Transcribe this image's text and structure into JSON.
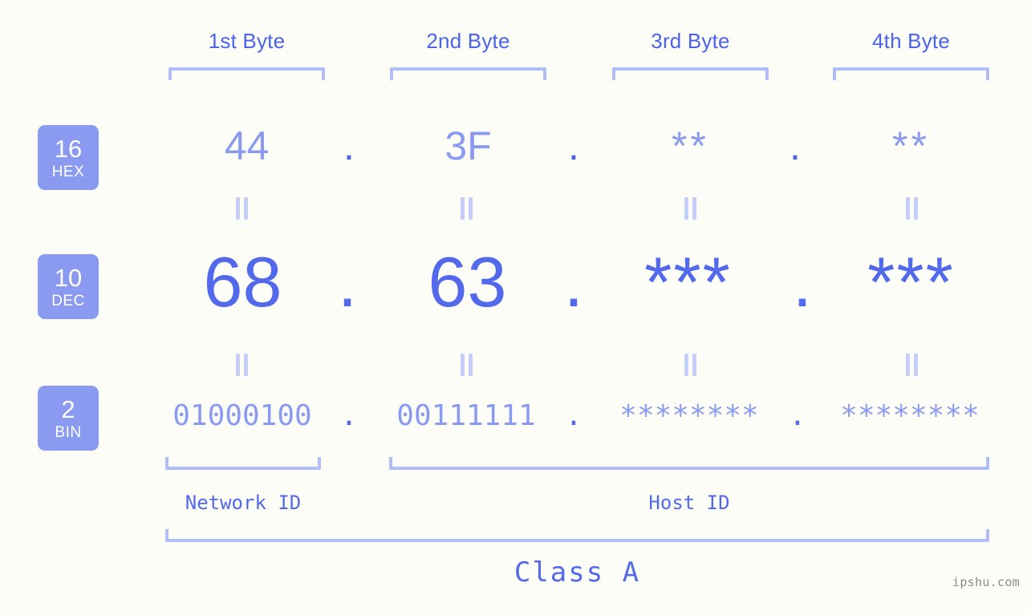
{
  "background_color": "#fdfdf8",
  "accent_colors": {
    "strong_blue": "#5269ec",
    "header_blue": "#4a63e8",
    "mid_blue": "#8a9af0",
    "light_blue": "#b0bdf7",
    "pale_blue": "#c4cef9",
    "badge_bg": "#8a9af0",
    "badge_text": "#ffffff",
    "watermark": "#8a8a8a"
  },
  "headers": [
    {
      "label": "1st Byte"
    },
    {
      "label": "2nd Byte"
    },
    {
      "label": "3rd Byte"
    },
    {
      "label": "4th Byte"
    }
  ],
  "rows": [
    {
      "badge": {
        "number": "16",
        "name": "HEX"
      },
      "values": [
        "44",
        "3F",
        "**",
        "**"
      ],
      "separators": [
        ".",
        ".",
        "."
      ]
    },
    {
      "badge": {
        "number": "10",
        "name": "DEC"
      },
      "values": [
        "68",
        "63",
        "***",
        "***"
      ],
      "separators": [
        ".",
        ".",
        "."
      ]
    },
    {
      "badge": {
        "number": "2",
        "name": "BIN"
      },
      "values": [
        "01000100",
        "00111111",
        "********",
        "********"
      ],
      "separators": [
        ".",
        ".",
        "."
      ]
    }
  ],
  "equals_symbol": "=",
  "sections": {
    "network_id": "Network ID",
    "host_id": "Host ID",
    "class": "Class A"
  },
  "watermark": "ipshu.com"
}
